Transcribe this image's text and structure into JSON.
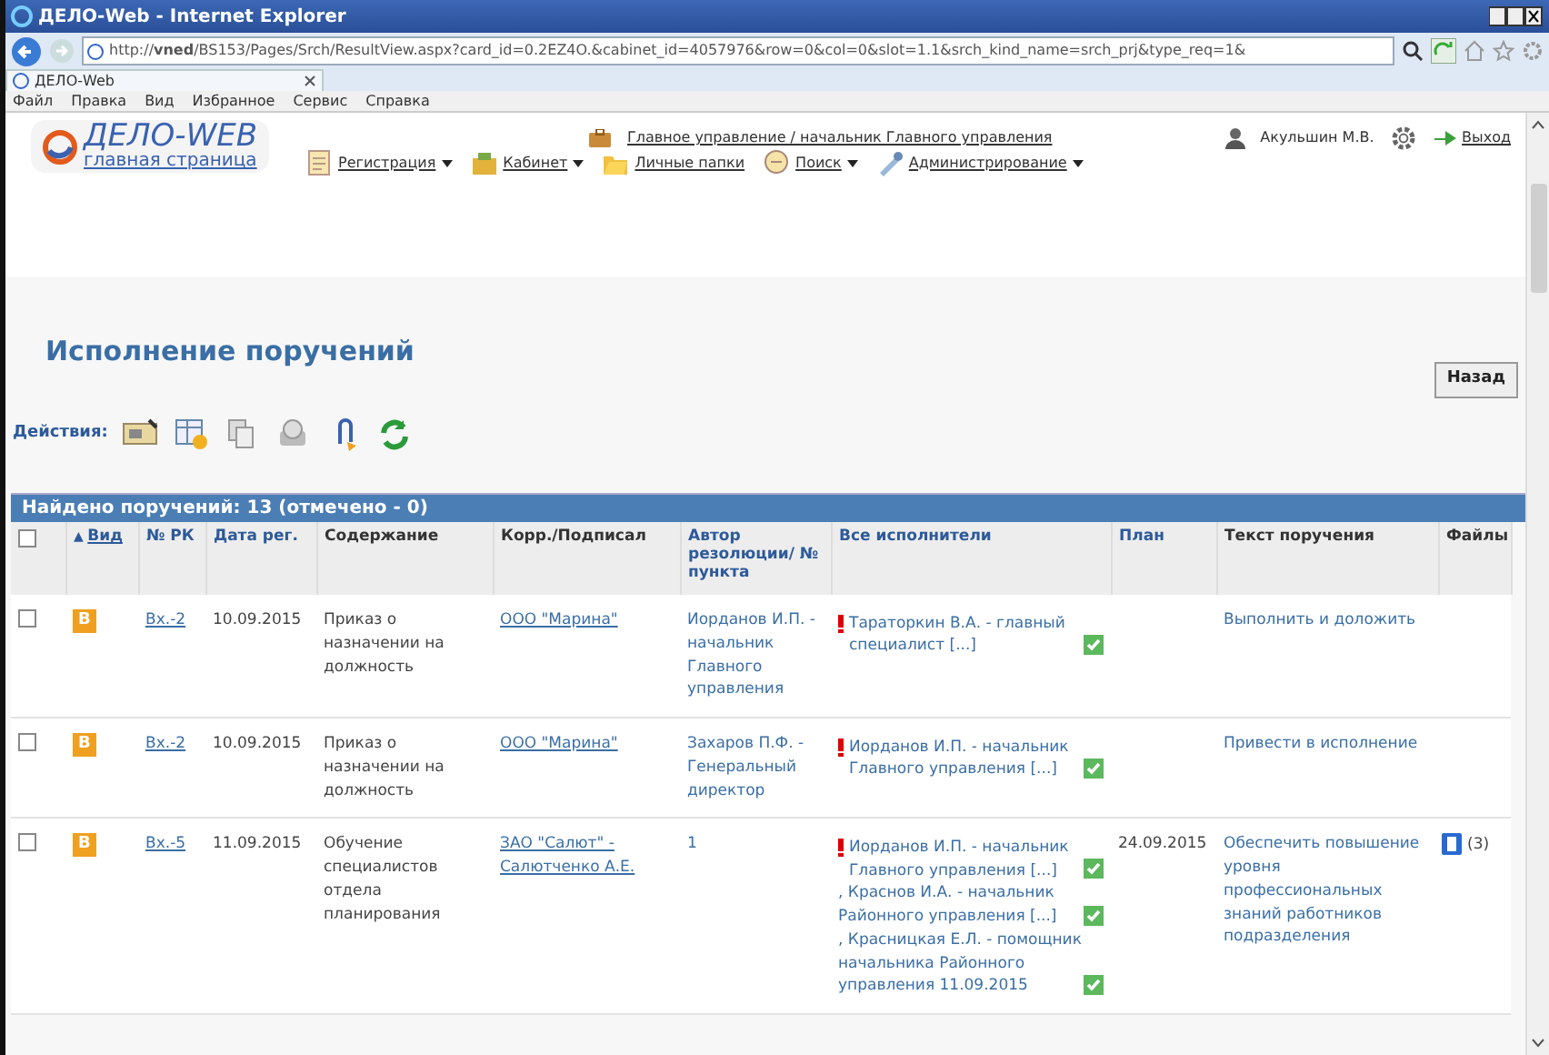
{
  "browser": {
    "title": "ДЕЛО-Web - Internet Explorer",
    "url": "http://**vned**/BS153/Pages/Srch/ResultView.aspx?card_id=0.2EZ4O.&cabinet_id=4057976&row=0&col=0&slot=1.1&srch_kind_name=srch_prj&type_req=1&",
    "tab": "ДЕЛО-Web",
    "menu": [
      "Файл",
      "Правка",
      "Вид",
      "Избранное",
      "Сервис",
      "Справка"
    ]
  },
  "app": {
    "logo": "ДЕЛО-WEB",
    "logo_subtitle": "главная страница",
    "post": "Главное управление / начальник Главного управления",
    "user": "Акульшин М.В.",
    "logout": "Выход",
    "nav": [
      {
        "label": "Регистрация",
        "dropdown": true
      },
      {
        "label": "Кабинет",
        "dropdown": true
      },
      {
        "label": "Личные папки",
        "dropdown": false
      },
      {
        "label": "Поиск",
        "dropdown": true
      },
      {
        "label": "Администрирование",
        "dropdown": true
      }
    ]
  },
  "page": {
    "title": "Исполнение поручений",
    "back": "Назад",
    "actions_label": "Действия:"
  },
  "table": {
    "caption": "Найдено поручений: 13 (отмечено - 0)",
    "all_checked": false,
    "columns": [
      {
        "label": "Вид",
        "link": true,
        "sort": "▲"
      },
      {
        "label": "№ РК",
        "link": true
      },
      {
        "label": "Дата рег.",
        "link": true
      },
      {
        "label": "Содержание",
        "link": false
      },
      {
        "label": "Корр./Подписал",
        "link": false
      },
      {
        "label": "Автор резолюции/ № пункта",
        "link": true
      },
      {
        "label": "Все исполнители",
        "link": true
      },
      {
        "label": "План",
        "link": true
      },
      {
        "label": "Текст поручения",
        "link": false
      },
      {
        "label": "Файлы",
        "link": false
      }
    ],
    "rows": [
      {
        "checked": false,
        "type": "В",
        "rk": "Вх.-2",
        "date": "10.09.2015",
        "content": "Приказ о назначении на должность",
        "corr": "ООО \"Марина\"",
        "author": "Иорданов И.П. - начальник Главного управления",
        "urgent": true,
        "executors": [
          {
            "text": "Тараторкин В.А. - главный специалист [...]",
            "done": true
          }
        ],
        "plan": "",
        "task": "Выполнить и доложить",
        "files": ""
      },
      {
        "checked": false,
        "type": "В",
        "rk": "Вх.-2",
        "date": "10.09.2015",
        "content": "Приказ о назначении на должность",
        "corr": "ООО \"Марина\"",
        "author": "Захаров П.Ф. - Генеральный директор",
        "urgent": true,
        "executors": [
          {
            "text": "Иорданов И.П. - начальник Главного управления [...]",
            "done": true
          }
        ],
        "plan": "",
        "task": "Привести в исполнение",
        "files": ""
      },
      {
        "checked": false,
        "type": "В",
        "rk": "Вх.-5",
        "date": "11.09.2015",
        "content": "Обучение специалистов отдела планирования",
        "corr": "ЗАО \"Салют\" - Салютченко А.Е.",
        "author": "1",
        "urgent": true,
        "executors": [
          {
            "text": "Иорданов И.П. - начальник Главного управления [...]",
            "done": true
          },
          {
            "text": ", Краснов И.А. - начальник Районного управления [...]",
            "done": true
          },
          {
            "text": ", Красницкая Е.Л. - помощник начальника Районного управления 11.09.2015",
            "done": true
          }
        ],
        "plan": "24.09.2015",
        "task": "Обеспечить повышение уровня профессиональных знаний работников подразделения",
        "files": "(3)"
      }
    ]
  }
}
